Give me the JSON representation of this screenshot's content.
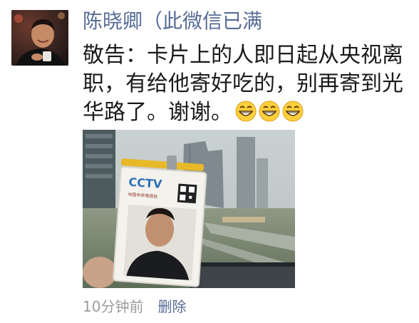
{
  "post": {
    "author": "陈晓卿（此微信已满",
    "text_lines": [
      "敬告：卡片上的人即日起从央视离",
      "职，有给他寄好吃的，别再寄到光",
      "华路了。谢谢。"
    ],
    "emoji": [
      "grin-emoji",
      "grin-emoji",
      "grin-emoji"
    ],
    "photo": {
      "badge_logo": "CCTV",
      "badge_subtitle": "中国中央电视台"
    },
    "timestamp": "10分钟前",
    "delete_label": "删除"
  },
  "colors": {
    "author_name": "#576b95",
    "body_text": "#1a1a1a",
    "timestamp": "#9b9b9b",
    "link": "#576b95",
    "badge_lanyard": "#e7b928"
  }
}
